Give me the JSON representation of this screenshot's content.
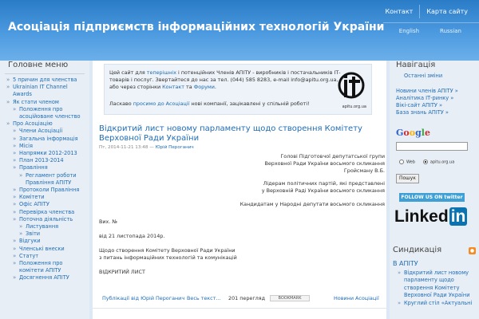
{
  "header": {
    "title": "Асоціація підприємств інформаційних технологій України",
    "top_links": [
      "Контакт",
      "Карта сайту"
    ],
    "languages": [
      "English",
      "Russian"
    ]
  },
  "left": {
    "heading": "Головне меню",
    "items": [
      {
        "label": "5 причин для членства",
        "level": 1
      },
      {
        "label": "Ukrainian IT Channel Awards",
        "level": 1
      },
      {
        "label": "Як стати членом",
        "level": 1
      },
      {
        "label": "Положення про асоційоване членство",
        "level": 2
      },
      {
        "label": "Про Асоціацію",
        "level": 1
      },
      {
        "label": "Члени Асоціації",
        "level": 2
      },
      {
        "label": "Загальна інформація",
        "level": 2
      },
      {
        "label": "Місія",
        "level": 2
      },
      {
        "label": "Напрямки 2012-2013",
        "level": 2
      },
      {
        "label": "План 2013-2014",
        "level": 2
      },
      {
        "label": "Правління",
        "level": 2
      },
      {
        "label": "Регламент роботи Правління АПІТУ",
        "level": 3
      },
      {
        "label": "Протоколи Правління",
        "level": 2
      },
      {
        "label": "Комітети",
        "level": 2
      },
      {
        "label": "Офіс АПІТУ",
        "level": 2
      },
      {
        "label": "Перевірка членства",
        "level": 2
      },
      {
        "label": "Поточна діяльність",
        "level": 2
      },
      {
        "label": "Листування",
        "level": 3
      },
      {
        "label": "Звіти",
        "level": 3
      },
      {
        "label": "Відгуки",
        "level": 2
      },
      {
        "label": "Членські внески",
        "level": 2
      },
      {
        "label": "Статут",
        "level": 2
      },
      {
        "label": "Положення про комітети АПІТУ",
        "level": 2
      },
      {
        "label": "Досягнення АПІТУ",
        "level": 2
      }
    ]
  },
  "notice": {
    "line1_pre": "Цей сайт для ",
    "line1_link": "теперішніх",
    "line1_post": " і потенційних Членів АПІТУ - виробників і постачальників ІТ-товарів і послуг. Звертайтеся до нас за тел. (044) 585 8283, e-mail info@apitu.org.ua, або через сторінки ",
    "contact_link": "Контакт",
    "and": " та ",
    "forum_link": "Форуми",
    "line2_pre": "Ласкаво ",
    "line2_link": "просимо до Асоціації",
    "line2_post": " нові компанії, зацікавлені у спільній роботі!",
    "logo_caption": "apitu.org.ua"
  },
  "article": {
    "title": "Відкритий лист новому парламенту щодо створення Комітету Верховної Ради України",
    "date": "Пт, 2014-11-21 13:48 — ",
    "author": "Юрій Пероганич",
    "to1": [
      "Голові Підготовчої депутатської групи",
      "Верховної Ради України восьмого скликання",
      "Гройсману В.Б."
    ],
    "to2": [
      "Лідерам політичних партій, які представлені",
      "у Верховній Раді України восьмого скликання"
    ],
    "to3": "Кандидатам у Народні депутати восьмого скликання",
    "ref": "Вих. №",
    "date_line": "від 21 листопада 2014р.",
    "subject": [
      "Щодо створення Комітету Верховної Ради України",
      "з питань інформаційних технологій та комунікацій"
    ],
    "open_letter": "ВІДКРИТИЙ ЛИСТ",
    "footer_author": "Публікації від Юрій Пероганич",
    "footer_full": "Весь текст...",
    "footer_views": "201 перегляд",
    "bookmark": "BOOKMARK",
    "footer_news": "Новини Асоціації"
  },
  "right": {
    "nav_heading": "Навігація",
    "nav_items": [
      "Останні зміни"
    ],
    "links": [
      "Новини членів АПІТУ »",
      "Аналітика ІТ-ринку »",
      "Вікі-сайт АПІТУ »",
      "База знань АПІТУ »"
    ],
    "google": "Google",
    "radio_web": "Web",
    "radio_site": "apitu.org.ua",
    "search_button": "Пошук",
    "twitter": "FOLLOW US ON twitter",
    "linkedin_a": "Linked",
    "linkedin_b": "in",
    "synd_heading": "Синдикація",
    "synd_sub": "В АПІТУ",
    "synd_items": [
      "Відкритий лист новому парламенту щодо створення Комітету Верховної Ради України",
      "Круглий стіл «Актуальні"
    ]
  }
}
